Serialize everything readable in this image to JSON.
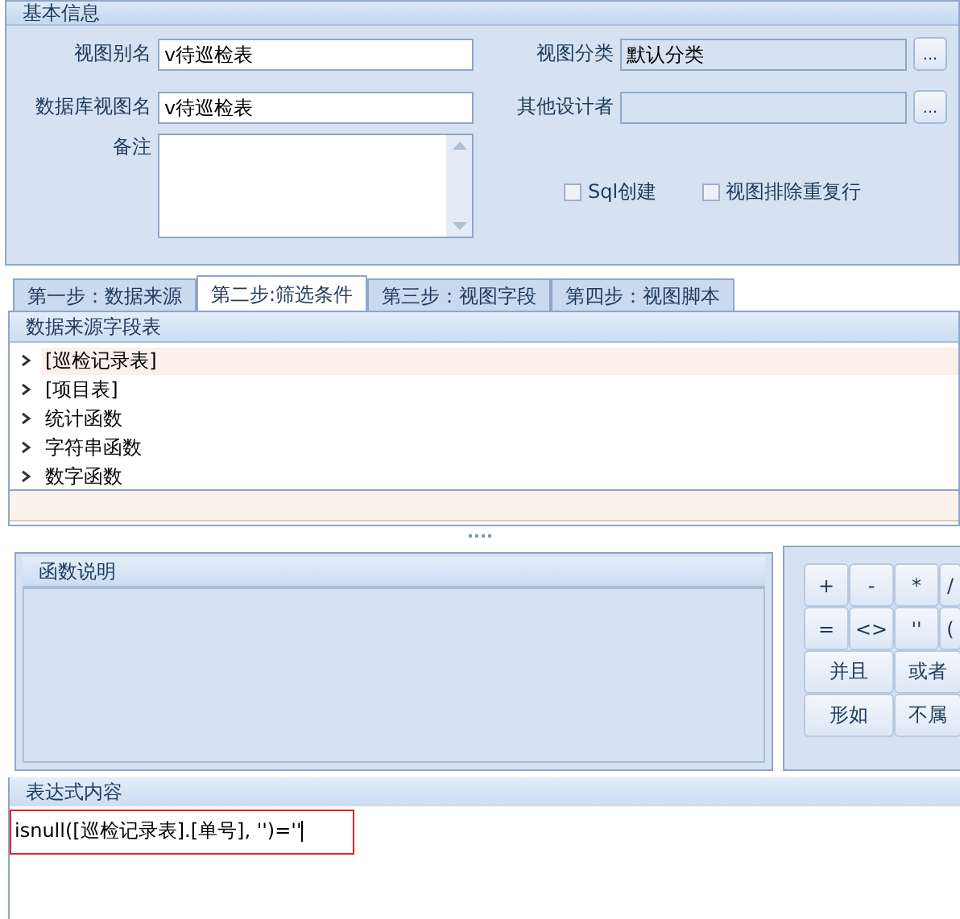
{
  "basic_info": {
    "title": "基本信息",
    "fields": [
      {
        "label": "视图别名",
        "value": "v待巡检表"
      },
      {
        "label": "视图分类",
        "value": "默认分类",
        "button_label": "..."
      },
      {
        "label": "数据库视图名",
        "value": "v待巡检表"
      },
      {
        "label": "其他设计者",
        "button_label": "..."
      }
    ],
    "remark": {
      "label": "备注"
    },
    "checkboxes": [
      {
        "label": "Sql创建",
        "checked": false
      },
      {
        "label": "视图排除重复行",
        "checked": false
      }
    ]
  },
  "tabs": [
    {
      "label": "第一步：数据来源",
      "selected": false
    },
    {
      "label": "第二步:筛选条件",
      "selected": true
    },
    {
      "label": "第三步：视图字段",
      "selected": false
    },
    {
      "label": "第四步：视图脚本",
      "selected": false
    }
  ],
  "source_fields": {
    "title": "数据来源字段表",
    "items": [
      {
        "label": "[巡检记录表]",
        "selected": true,
        "expanded": false
      },
      {
        "label": "[项目表]",
        "selected": false,
        "expanded": false
      },
      {
        "label": "统计函数",
        "selected": false,
        "expanded": false
      },
      {
        "label": "字符串函数",
        "selected": false,
        "expanded": false
      },
      {
        "label": "数字函数",
        "selected": false,
        "expanded": false
      }
    ]
  },
  "function_help": {
    "title": "函数说明"
  },
  "operator_rows": [
    [
      "+",
      "-",
      "*",
      "/"
    ],
    [
      "=",
      "<>",
      "''",
      "("
    ],
    [
      "并且",
      "或者"
    ],
    [
      "形如",
      "不属"
    ]
  ],
  "expression": {
    "title": "表达式内容",
    "value": "isnull([巡检记录表].[单号], '')=''"
  }
}
